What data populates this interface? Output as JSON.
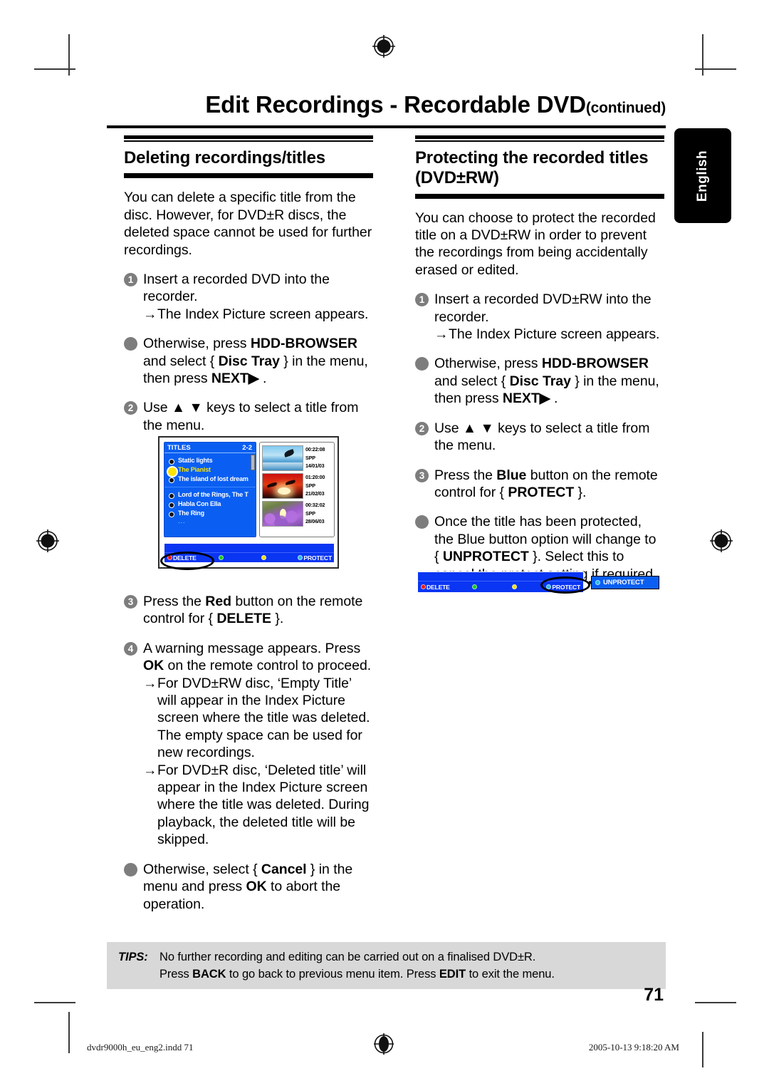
{
  "header": {
    "title": "Edit Recordings - Recordable DVD",
    "title_suffix": "(continued)"
  },
  "lang_tab": {
    "label": "English"
  },
  "left_column": {
    "heading": "Deleting recordings/titles",
    "intro": "You can delete a specific title from the disc. However, for DVD±R discs, the deleted space cannot be used for further recordings.",
    "step1_marker": "1",
    "step1_text": "Insert a recorded DVD into the recorder.",
    "step1_sub_arrow": "→",
    "step1_sub": "The Index Picture screen appears.",
    "bullet1_pre": "Otherwise, press ",
    "bullet1_b1": "HDD-BROWSER",
    "bullet1_mid": " and select { ",
    "bullet1_b2": "Disc Tray",
    "bullet1_mid2": " } in the menu, then press ",
    "bullet1_b3": "NEXT",
    "bullet1_arrow": "▶",
    "bullet1_end": " .",
    "step2_marker": "2",
    "step2_pre": "Use ",
    "step2_up": "▲",
    "step2_down": "▼",
    "step2_post": " keys to select a title from the menu.",
    "step3_marker": "3",
    "step3_pre": "Press the ",
    "step3_b1": "Red",
    "step3_mid": " button on the remote control for { ",
    "step3_b2": "DELETE",
    "step3_end": " }.",
    "step4_marker": "4",
    "step4_pre": "A warning message appears. Press ",
    "step4_b1": "OK",
    "step4_post": " on the remote control to proceed.",
    "step4_sub1_arrow": "→",
    "step4_sub1": "For DVD±RW disc, ‘Empty Title’ will appear in the Index Picture screen where the title was deleted. The empty space can be used for new recordings.",
    "step4_sub2_arrow": "→",
    "step4_sub2": "For DVD±R disc, ‘Deleted title’ will appear in the Index Picture screen where the title was deleted. During playback, the deleted title will be skipped.",
    "bullet2_pre": "Otherwise, select { ",
    "bullet2_b1": "Cancel",
    "bullet2_mid": " } in the menu and press ",
    "bullet2_b2": "OK",
    "bullet2_end": " to abort the operation."
  },
  "right_column": {
    "heading_line1": "Protecting the recorded titles",
    "heading_line2": "(DVD±RW)",
    "intro": "You can choose to protect the recorded title on a DVD±RW in order to prevent the recordings from being accidentally erased or edited.",
    "step1_marker": "1",
    "step1_text": "Insert a recorded DVD±RW into the recorder.",
    "step1_sub_arrow": "→",
    "step1_sub": "The Index Picture screen appears.",
    "bullet1_pre": "Otherwise, press ",
    "bullet1_b1": "HDD-BROWSER",
    "bullet1_mid": " and select { ",
    "bullet1_b2": "Disc Tray",
    "bullet1_mid2": " } in the menu, then press ",
    "bullet1_b3": "NEXT",
    "bullet1_arrow": "▶",
    "bullet1_end": " .",
    "step2_marker": "2",
    "step2_pre": "Use ",
    "step2_up": "▲",
    "step2_down": "▼",
    "step2_post": " keys to select a title from the menu.",
    "step3_marker": "3",
    "step3_pre": "Press the ",
    "step3_b1": "Blue",
    "step3_mid": " button on the remote control for { ",
    "step3_b2": "PROTECT",
    "step3_end": " }.",
    "bullet2_pre": "Once the title has been protected, the Blue button option will change to { ",
    "bullet2_b1": "UNPROTECT",
    "bullet2_post": " }. Select this to cancel the protect setting if required."
  },
  "tv_screen": {
    "list_title": "TITLES",
    "page_indicator": "2-2",
    "groups": [
      {
        "items": [
          {
            "label": "Static lights",
            "selected": false
          },
          {
            "label": "The Pianist",
            "selected": true
          },
          {
            "label": "The island of lost dream",
            "selected": false
          }
        ]
      },
      {
        "items": [
          {
            "label": "Lord of the Rings, The T",
            "selected": false
          },
          {
            "label": "Habla Con Ella",
            "selected": false
          },
          {
            "label": "The Ring",
            "selected": false
          }
        ],
        "ellipsis": "..."
      }
    ],
    "thumbnails": [
      {
        "art": "sea",
        "duration": "00:22:08",
        "mode": "SPP",
        "date": "14/01/03"
      },
      {
        "art": "sunset",
        "duration": "01:20:00",
        "mode": "SPP",
        "date": "21/02/03"
      },
      {
        "art": "coral",
        "duration": "00:32:02",
        "mode": "SPP",
        "date": "28/06/03"
      }
    ],
    "keybar": [
      {
        "label": "DELETE",
        "color": "#e8181c",
        "highlight": true
      },
      {
        "label": "",
        "color": "#18c818",
        "highlight": false
      },
      {
        "label": "",
        "color": "#f2e014",
        "highlight": false
      },
      {
        "label": "PROTECT",
        "color": "#30b8f0",
        "highlight": false
      }
    ]
  },
  "protect_figure": {
    "keybar": [
      {
        "label": "DELETE",
        "color": "#e8181c",
        "highlight": false
      },
      {
        "label": "",
        "color": "#18c818",
        "highlight": false
      },
      {
        "label": "",
        "color": "#f2e014",
        "highlight": false
      },
      {
        "label": "PROTECT",
        "color": "#30b8f0",
        "highlight": true
      }
    ],
    "unprotect_label": "UNPROTECT",
    "unprotect_dot_color": "#30b8f0"
  },
  "tips": {
    "label": "TIPS:",
    "line1": "No further recording and editing can be carried out on a finalised DVD±R.",
    "line2_pre": "Press ",
    "line2_b1": "BACK",
    "line2_mid": " to go back to previous menu item. Press ",
    "line2_b2": "EDIT",
    "line2_end": " to exit the menu."
  },
  "page_number": "71",
  "footer": {
    "file": "dvdr9000h_eu_eng2.indd   71",
    "timestamp": "2005-10-13   9:18:20 AM"
  },
  "colors": {
    "menu_blue": "#0a5ff2",
    "keybar_blue": "#0a35f2",
    "selected_yellow": "#ffe400",
    "tips_bg": "#d8d8d8",
    "marker_gray": "#7d7d7d"
  }
}
